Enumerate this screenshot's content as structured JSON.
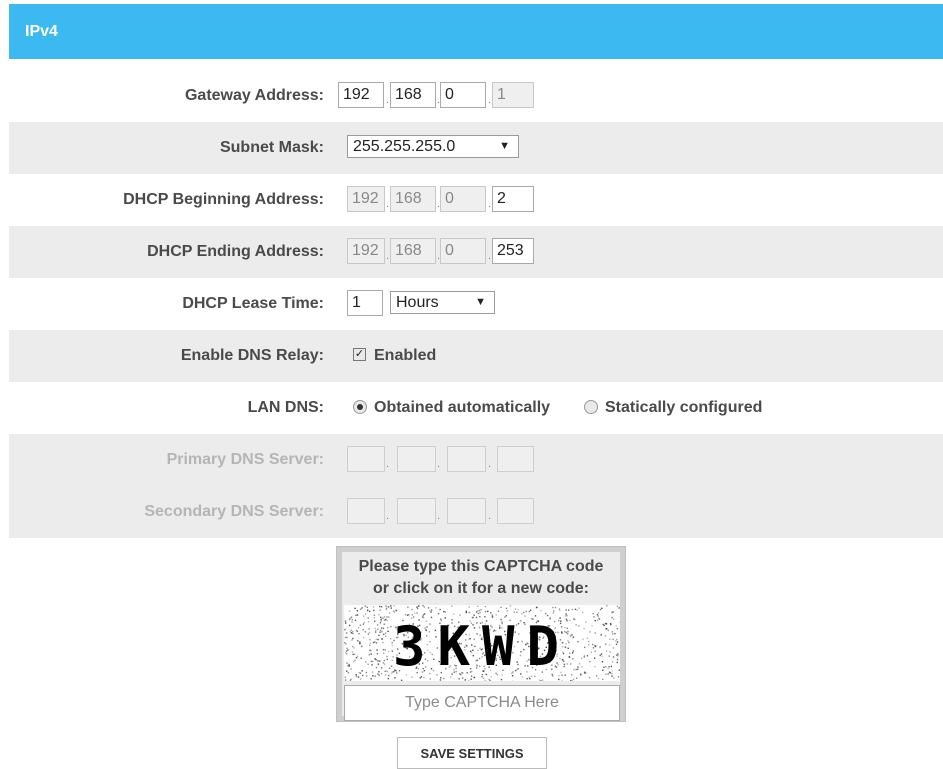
{
  "section": {
    "title": "IPv4"
  },
  "gateway": {
    "label": "Gateway Address:",
    "octets": [
      "192",
      "168",
      "0",
      "1"
    ]
  },
  "subnet": {
    "label": "Subnet Mask:",
    "selected": "255.255.255.0"
  },
  "dhcp_begin": {
    "label": "DHCP Beginning Address:",
    "octets": [
      "192",
      "168",
      "0",
      "2"
    ]
  },
  "dhcp_end": {
    "label": "DHCP Ending Address:",
    "octets": [
      "192",
      "168",
      "0",
      "253"
    ]
  },
  "lease": {
    "label": "DHCP Lease Time:",
    "value": "1",
    "unit": "Hours"
  },
  "dns_relay": {
    "label": "Enable DNS Relay:",
    "option": "Enabled",
    "checked": true
  },
  "lan_dns": {
    "label": "LAN DNS:",
    "option_auto": "Obtained automatically",
    "option_static": "Statically configured",
    "selected": "auto"
  },
  "primary_dns": {
    "label": "Primary DNS Server:",
    "octets": [
      "",
      "",
      "",
      ""
    ]
  },
  "secondary_dns": {
    "label": "Secondary DNS Server:",
    "octets": [
      "",
      "",
      "",
      ""
    ]
  },
  "captcha": {
    "prompt_line1": "Please type this CAPTCHA code",
    "prompt_line2": "or click on it for a new code:",
    "code": "3KWD",
    "placeholder": "Type CAPTCHA Here"
  },
  "save_label": "SAVE SETTINGS",
  "colors": {
    "header_bg": "#3cb9f0",
    "row_shade": "#ececec",
    "disabled_label": "#b5b5b5"
  }
}
